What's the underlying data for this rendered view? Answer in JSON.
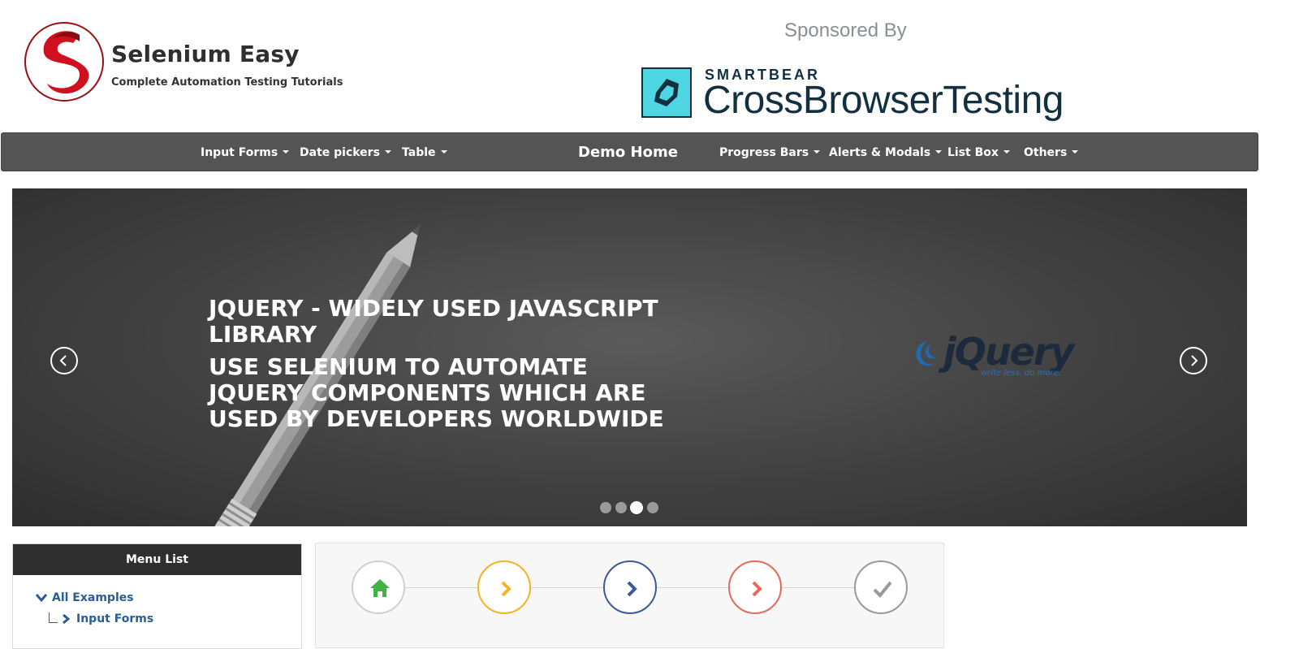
{
  "header": {
    "brand_name": "Selenium Easy",
    "brand_tagline": "Complete Automation Testing Tutorials",
    "sponsored_label": "Sponsored By",
    "sponsor_small": "SMARTBEAR",
    "sponsor_big": "CrossBrowserTesting"
  },
  "navbar": {
    "left_items": [
      "Input Forms",
      "Date pickers",
      "Table"
    ],
    "home": "Demo Home",
    "right_items": [
      "Progress Bars",
      "Alerts & Modals",
      "List Box",
      "Others"
    ]
  },
  "carousel": {
    "title": "JQUERY - WIDELY USED JAVASCRIPT LIBRARY",
    "subtitle": "USE SELENIUM TO AUTOMATE JQUERY COMPONENTS WHICH ARE USED BY DEVELOPERS WORLDWIDE",
    "jquery_word": "jQuery",
    "jquery_tagline": "write less, do more.",
    "slide_count": 4,
    "active_slide": 3
  },
  "menu": {
    "header": "Menu List",
    "root": "All Examples",
    "child": "Input Forms"
  },
  "steps": [
    {
      "icon": "home-icon",
      "color": "#3fb344",
      "border": "#d0d0d0"
    },
    {
      "icon": "chevron-right-icon",
      "color": "#f5b324",
      "border": "#f5b324"
    },
    {
      "icon": "chevron-right-icon",
      "color": "#3a5a99",
      "border": "#3a5a99"
    },
    {
      "icon": "chevron-right-icon",
      "color": "#e56a5e",
      "border": "#e56a5e"
    },
    {
      "icon": "check-icon",
      "color": "#999999",
      "border": "#999999"
    }
  ],
  "colors": {
    "navbar_bg": "#545454",
    "brand_red": "#c8102e",
    "link_blue": "#2a5d96"
  }
}
